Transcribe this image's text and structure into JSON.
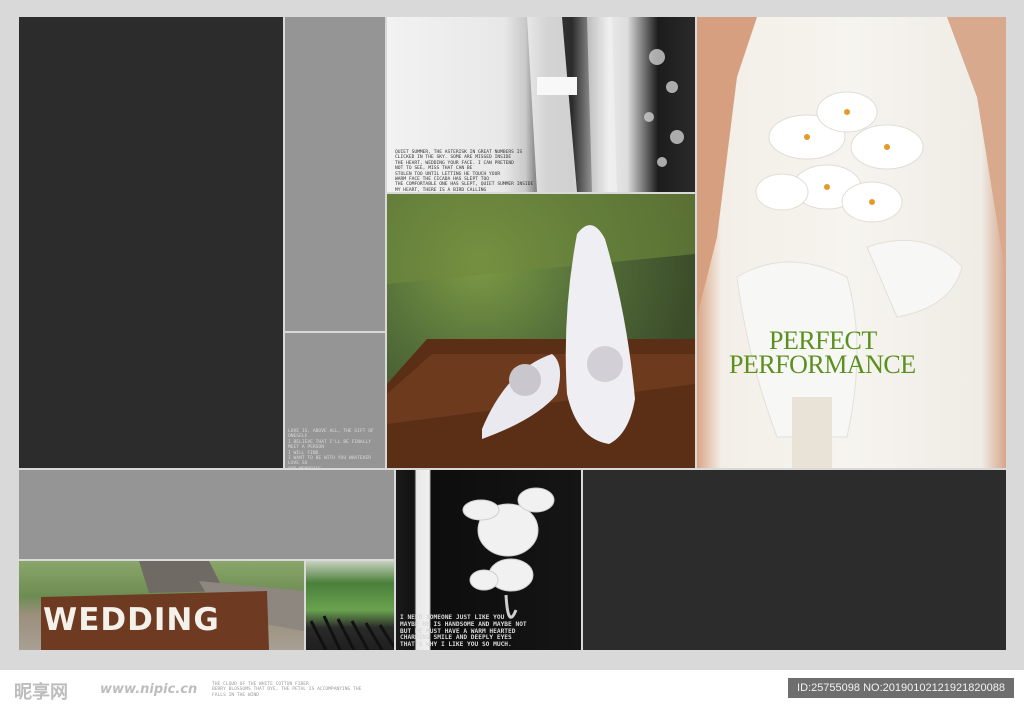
{
  "photo_texts": {
    "veil_caption": "QUIET SUMMER, THE ASTERISK IN GREAT NUMBERS IS\nCLICKED IN THE SKY. SOME ARE MISSED INSIDE\nTHE HEART, WEDDING YOUR FACE. I CAN PRETEND\nNOT TO SEE, MISS THAT CAN BE\nSTOLEN TOO UNTIL LETTING HE TOUCH YOUR\nWARM FACE THE CICADA HAS SLEPT TOO\nTHE COMFORTABLE ONE HAS SLEPT, QUIET SUMMER INSIDE\nMY HEART, THERE IS A BIRD CALLING\nYOU CAME THAT DAY OF NINGXIA AGO",
    "grey_caption": "LOVE IS, ABOVE ALL, THE GIFT OF ONESELF\nI BELIEVE THAT I'LL BE FINALLY\nMEET A PERSON\nI WILL FIND\nI WANT TO BE WITH YOU WHATEVER\nLOVE SO\nOUR MEMORIES\nEVOLUTION ONE WILL\nEVEN LOVE ANYONE AS MUCH AS I LOVE YOU",
    "perfect_line1": "PERFECT",
    "perfect_line2": "PERFORMANCE",
    "sign_text": "WEDDING",
    "bout_caption": "I NEED SOMEONE JUST LIKE YOU\nMAYBE HE IS HANDSOME AND MAYBE NOT\nBUT HE MUST HAVE A WARM HEARTED\nCHARMING SMILE AND DEEPLY EYES\nTHAT'S WHY I LIKE YOU SO MUCH.",
    "footer_small_caption": "THE CLOUD OF THE WHITE COTTON FIBER\nBERRY BLOSSOMS THAT DYE, THE PETAL IS ACCOMPANYING THE\nFALLS IN THE WIND"
  },
  "footer": {
    "watermark_logo": "昵享网",
    "watermark_url": "www.nipic.cn",
    "id_text": "ID:25755098 NO:20190102121921820088"
  },
  "colors": {
    "accent_green": "#5b8f1e",
    "dark_panel": "#2c2c2c",
    "grey_panel": "#959595"
  }
}
